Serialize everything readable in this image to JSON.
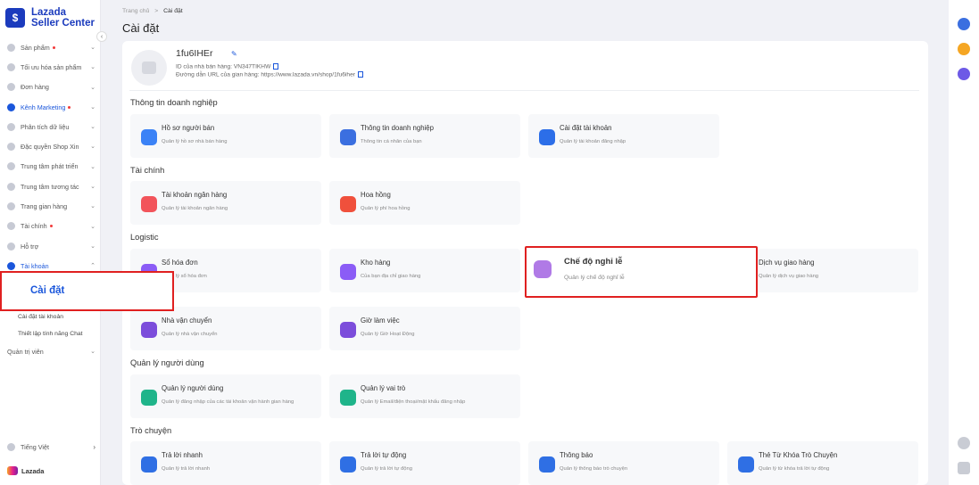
{
  "app": {
    "brand_line1": "Lazada",
    "brand_line2": "Seller Center",
    "footer_brand": "Lazada"
  },
  "sidebar": {
    "items": [
      {
        "label": "Sản phẩm",
        "dot": true
      },
      {
        "label": "Tối ưu hóa sản phẩm",
        "dot": false
      },
      {
        "label": "Đơn hàng",
        "dot": false
      },
      {
        "label": "Kênh Marketing",
        "dot": true
      },
      {
        "label": "Phân tích dữ liệu",
        "dot": false
      },
      {
        "label": "Đặc quyền Shop Xin",
        "dot": false
      },
      {
        "label": "Trung tâm phát triển",
        "dot": false
      },
      {
        "label": "Trung tâm tương tác",
        "dot": false
      },
      {
        "label": "Trang gian hàng",
        "dot": false
      },
      {
        "label": "Tài chính",
        "dot": true
      },
      {
        "label": "Hỗ trợ",
        "dot": false
      },
      {
        "label": "Tài khoản",
        "dot": false
      }
    ],
    "active_sub": "Cài đặt",
    "sub_items": [
      "Cài đặt tài khoản",
      "Thiết lập tính năng Chat"
    ],
    "admin": "Quản trị viên",
    "language": "Tiếng Việt"
  },
  "breadcrumb": {
    "home": "Trang chủ",
    "sep": ">",
    "current": "Cài đặt"
  },
  "page_title": "Cài đặt",
  "profile": {
    "shop_name": "1fu6IHEr",
    "seller_id": "ID của nhà bán hàng: VN347TIKHW",
    "store_url": "Đường dẫn URL của gian hàng: https://www.lazada.vn/shop/1fu6iher"
  },
  "sections": {
    "business": "Thông tin doanh nghiệp",
    "finance": "Tài chính",
    "logistic": "Logistic",
    "users": "Quản lý người dùng",
    "chat": "Trò chuyện"
  },
  "tiles": {
    "seller_profile": {
      "title": "Hồ sơ người bán",
      "desc": "Quản lý hồ sơ nhà bán hàng",
      "color": "#3b82f6"
    },
    "business_info": {
      "title": "Thông tin doanh nghiệp",
      "desc": "Thông tin cá nhân của bạn",
      "color": "#3b6fe0"
    },
    "account_settings": {
      "title": "Cài đặt tài khoản",
      "desc": "Quản lý tài khoản đăng nhập",
      "color": "#2c6ee8"
    },
    "bank_account": {
      "title": "Tài khoản ngân hàng",
      "desc": "Quản lý tài khoản ngân hàng",
      "color": "#f2545b"
    },
    "commission": {
      "title": "Hoa hồng",
      "desc": "Quản lý phí hoa hồng",
      "color": "#f0503c"
    },
    "address_book": {
      "title": "Sổ hóa đơn",
      "desc": "Quản lý sổ hóa đơn",
      "color": "#8b5cf6"
    },
    "warehouse": {
      "title": "Kho hàng",
      "desc": "Của bạn địa chỉ giao hàng",
      "color": "#8b5cf6"
    },
    "holiday_mode": {
      "title": "Chế độ nghỉ lễ",
      "desc": "Quản lý chế độ nghỉ lễ",
      "color": "#b07ae6"
    },
    "delivery_service": {
      "title": "Dịch vụ giao hàng",
      "desc": "Quản lý dịch vụ giao hàng",
      "color": "#8b5cf6"
    },
    "carrier": {
      "title": "Nhà vận chuyển",
      "desc": "Quản lý nhà vận chuyển",
      "color": "#7c4ddb"
    },
    "business_hours": {
      "title": "Giờ làm việc",
      "desc": "Quản lý Giờ Hoạt Động",
      "color": "#7c4ddb"
    },
    "user_mgmt": {
      "title": "Quản lý người dùng",
      "desc": "Quản lý đăng nhập của các tài khoản vận hành gian hàng",
      "color": "#1fb48a"
    },
    "role_mgmt": {
      "title": "Quản lý vai trò",
      "desc": "Quản lý Email/điện thoại/mật khẩu đăng nhập",
      "color": "#1fb48a"
    },
    "quick_reply": {
      "title": "Trả lời nhanh",
      "desc": "Quản lý trả lời nhanh",
      "color": "#2f6fe4"
    },
    "auto_reply": {
      "title": "Trả lời tự động",
      "desc": "Quản lý trả lời tự động",
      "color": "#2f6fe4"
    },
    "notification": {
      "title": "Thông báo",
      "desc": "Quản lý thông báo trò chuyện",
      "color": "#2f6fe4"
    },
    "chat_keywords": {
      "title": "Thẻ Từ Khóa Trò Chuyện",
      "desc": "Quản lý từ khóa trả lời tự động",
      "color": "#2f6fe4"
    }
  }
}
